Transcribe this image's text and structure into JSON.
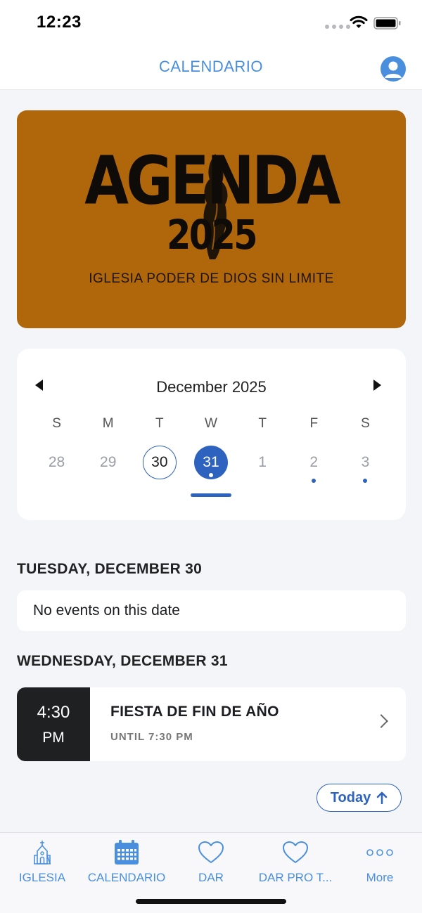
{
  "status_bar": {
    "time": "12:23"
  },
  "header": {
    "title": "CALENDARIO"
  },
  "banner": {
    "title": "AGENDA",
    "year": "2025",
    "subtitle": "IGLESIA PODER DE DIOS SIN LIMITE"
  },
  "calendar": {
    "month_label": "December 2025",
    "weekdays": [
      "S",
      "M",
      "T",
      "W",
      "T",
      "F",
      "S"
    ],
    "days": [
      {
        "num": "28",
        "state": "normal",
        "has_event": false
      },
      {
        "num": "29",
        "state": "normal",
        "has_event": false
      },
      {
        "num": "30",
        "state": "outlined",
        "has_event": false
      },
      {
        "num": "31",
        "state": "selected",
        "has_event": true
      },
      {
        "num": "1",
        "state": "normal",
        "has_event": false
      },
      {
        "num": "2",
        "state": "normal",
        "has_event": true
      },
      {
        "num": "3",
        "state": "normal",
        "has_event": true
      }
    ]
  },
  "sections": [
    {
      "header": "TUESDAY, DECEMBER 30",
      "empty_text": "No events on this date"
    },
    {
      "header": "WEDNESDAY, DECEMBER 31"
    }
  ],
  "event": {
    "time": "4:30",
    "ampm": "PM",
    "title": "FIESTA DE FIN DE AÑO",
    "until": "UNTIL 7:30 PM"
  },
  "today_button": {
    "label": "Today"
  },
  "tabs": [
    {
      "label": "IGLESIA",
      "icon": "church-icon"
    },
    {
      "label": "CALENDARIO",
      "icon": "calendar-icon"
    },
    {
      "label": "DAR",
      "icon": "heart-icon"
    },
    {
      "label": "DAR PRO T...",
      "icon": "heart-icon"
    },
    {
      "label": "More",
      "icon": "more-icon"
    }
  ],
  "colors": {
    "accent": "#4a8fde",
    "primary": "#2d62bf",
    "banner": "#b0660b"
  }
}
